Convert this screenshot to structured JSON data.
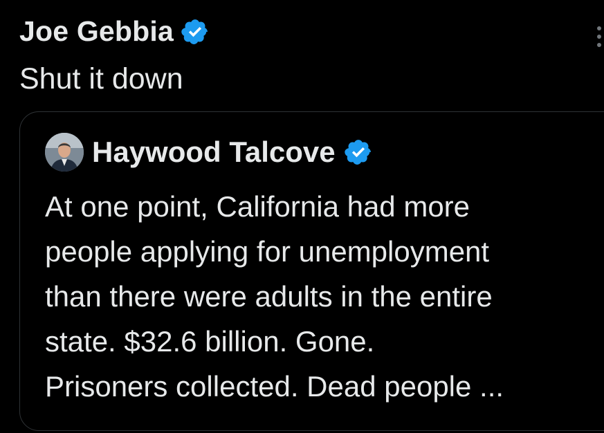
{
  "tweet": {
    "author": "Joe Gebbia",
    "verified_icon": "verified-badge",
    "text": "Shut it down",
    "more_icon": "more-vertical-icon"
  },
  "quote": {
    "author": "Haywood Talcove",
    "verified_icon": "verified-badge",
    "lines": [
      "At one point, California had more",
      "people applying for unemployment",
      "than there were adults in the entire",
      "state. $32.6 billion. Gone.",
      "Prisoners collected. Dead people ..."
    ]
  },
  "colors": {
    "background": "#000000",
    "text": "#e7e9ea",
    "verified": "#1d9bf0",
    "border": "#2f3336"
  }
}
